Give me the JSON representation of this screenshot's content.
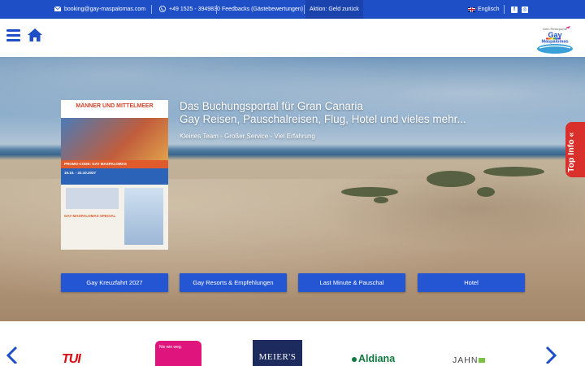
{
  "topbar": {
    "email": "booking@gay-maspalomas.com",
    "phone": "+49 1525 - 3949830",
    "feedback": "Feedbacks (Gästebewertungen)",
    "aktion": "Aktion: Geld zurück",
    "language": "Englisch"
  },
  "header": {
    "logo_small": "Dein Reiseportal",
    "logo_main": "Gay",
    "logo_sub": "Maspalomas"
  },
  "hero": {
    "title_line1": "Das Buchungsportal für Gran Canaria",
    "title_line2": "Gay Reisen, Pauschalreisen, Flug, Hotel und vieles mehr...",
    "subtitle": "Kleines Team - Großer Service - Viel Erfahrung",
    "poster": {
      "headline": "MÄNNER UND MITTELMEER",
      "promo": "PROMO-CODE: GAY MASPALOMAS",
      "dates": "19.10. - 22.10.2027",
      "special": "GAY MASPALOMAS SPECIAL"
    },
    "buttons": [
      "Gay Kreuzfahrt 2027",
      "Gay Resorts & Empfehlungen",
      "Last Minute & Pauschal",
      "Hotel"
    ]
  },
  "side_tab": {
    "label": "Top Info «"
  },
  "partners": {
    "tui": "TUI",
    "pink_text": "Nix wie weg.",
    "meiers": "MEIER'S",
    "aldiana": "Aldiana",
    "jahn": "JAHN"
  },
  "colors": {
    "brand_blue": "#1e4fc6",
    "button_blue": "#2456d3",
    "top_info_red": "#d9302b"
  }
}
